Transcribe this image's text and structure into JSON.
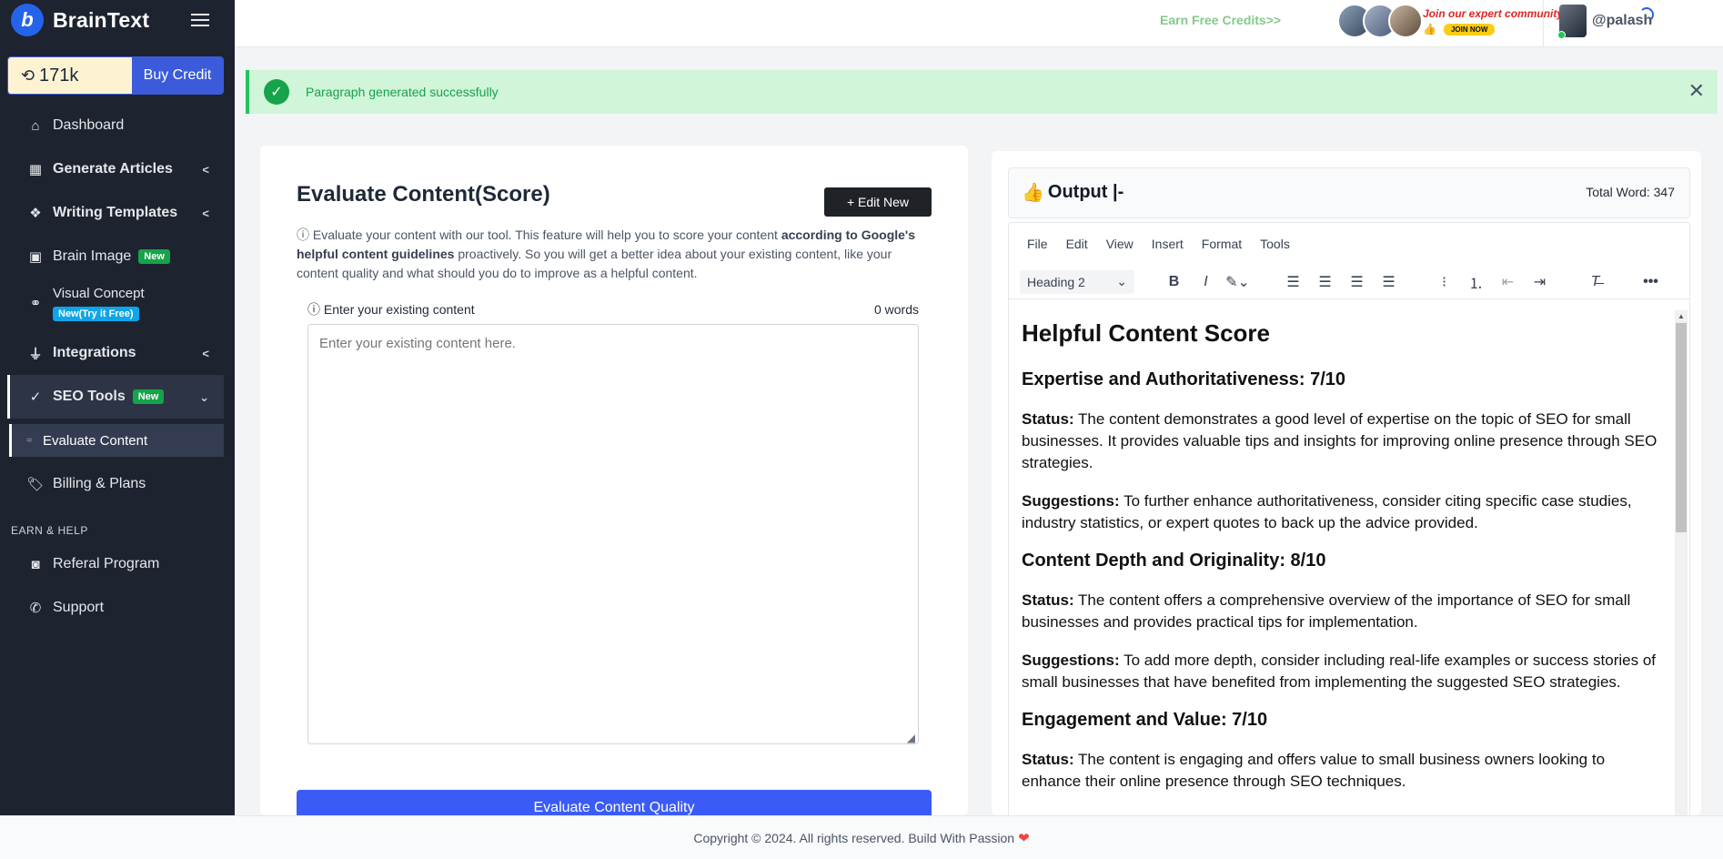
{
  "brand": {
    "name": "BrainText",
    "logo_letter": "b"
  },
  "credits": {
    "value": "171k",
    "buy_label": "Buy Credit"
  },
  "sidebar": {
    "items": [
      {
        "label": "Dashboard",
        "icon": "home-icon"
      },
      {
        "label": "Generate Articles",
        "icon": "grid-icon"
      },
      {
        "label": "Writing Templates",
        "icon": "layers-icon"
      },
      {
        "label": "Brain Image",
        "icon": "image-icon",
        "badge": "New"
      },
      {
        "label": "Visual Concept",
        "icon": "concept-icon",
        "badge": "New(Try it Free)"
      },
      {
        "label": "Integrations",
        "icon": "plug-icon"
      },
      {
        "label": "SEO Tools",
        "icon": "chart-icon",
        "badge": "New"
      },
      {
        "label": "Evaluate Content"
      },
      {
        "label": "Billing & Plans",
        "icon": "tag-icon"
      }
    ],
    "section_label": "EARN & HELP",
    "help_items": [
      {
        "label": "Referal Program",
        "icon": "camera-icon"
      },
      {
        "label": "Support",
        "icon": "phone-icon"
      }
    ]
  },
  "topbar": {
    "earn_link": "Earn Free Credits>>",
    "community_title": "Join our expert community",
    "join_now": "JOIN NOW",
    "username": "@palash"
  },
  "alert": {
    "message": "Paragraph generated successfully",
    "color": "#16a34a"
  },
  "evaluate": {
    "title": "Evaluate Content(Score)",
    "edit_new": "+ Edit New",
    "desc_pre": "Evaluate your content with our tool. This feature will help you to score your content ",
    "desc_bold": "according to Google's helpful content guidelines",
    "desc_post": " proactively. So you will get a better idea about your existing content, like your content quality and what should you do to improve as a helpful content.",
    "input_label": "Enter your existing content",
    "word_count": "0 words",
    "placeholder": "Enter your existing content here.",
    "button": "Evaluate Content Quality"
  },
  "output": {
    "title": "Output |-",
    "total_word": "Total Word: 347",
    "menu": [
      "File",
      "Edit",
      "View",
      "Insert",
      "Format",
      "Tools"
    ],
    "format_value": "Heading 2",
    "heading": "Helpful Content Score",
    "sections": [
      {
        "title": "Expertise and Authoritativeness: 7/10",
        "status": "The content demonstrates a good level of expertise on the topic of SEO for small businesses. It provides valuable tips and insights for improving online presence through SEO strategies.",
        "suggestions": "To further enhance authoritativeness, consider citing specific case studies, industry statistics, or expert quotes to back up the advice provided."
      },
      {
        "title": "Content Depth and Originality: 8/10",
        "status": "The content offers a comprehensive overview of the importance of SEO for small businesses and provides practical tips for implementation.",
        "suggestions": "To add more depth, consider including real-life examples or success stories of small businesses that have benefited from implementing the suggested SEO strategies."
      },
      {
        "title": "Engagement and Value: 7/10",
        "status": "The content is engaging and offers value to small business owners looking to enhance their online presence through SEO techniques."
      }
    ],
    "status_label": "Status:",
    "suggestions_label": "Suggestions:"
  },
  "footer": {
    "text": "Copyright © 2024. All rights reserved. Build With Passion"
  }
}
